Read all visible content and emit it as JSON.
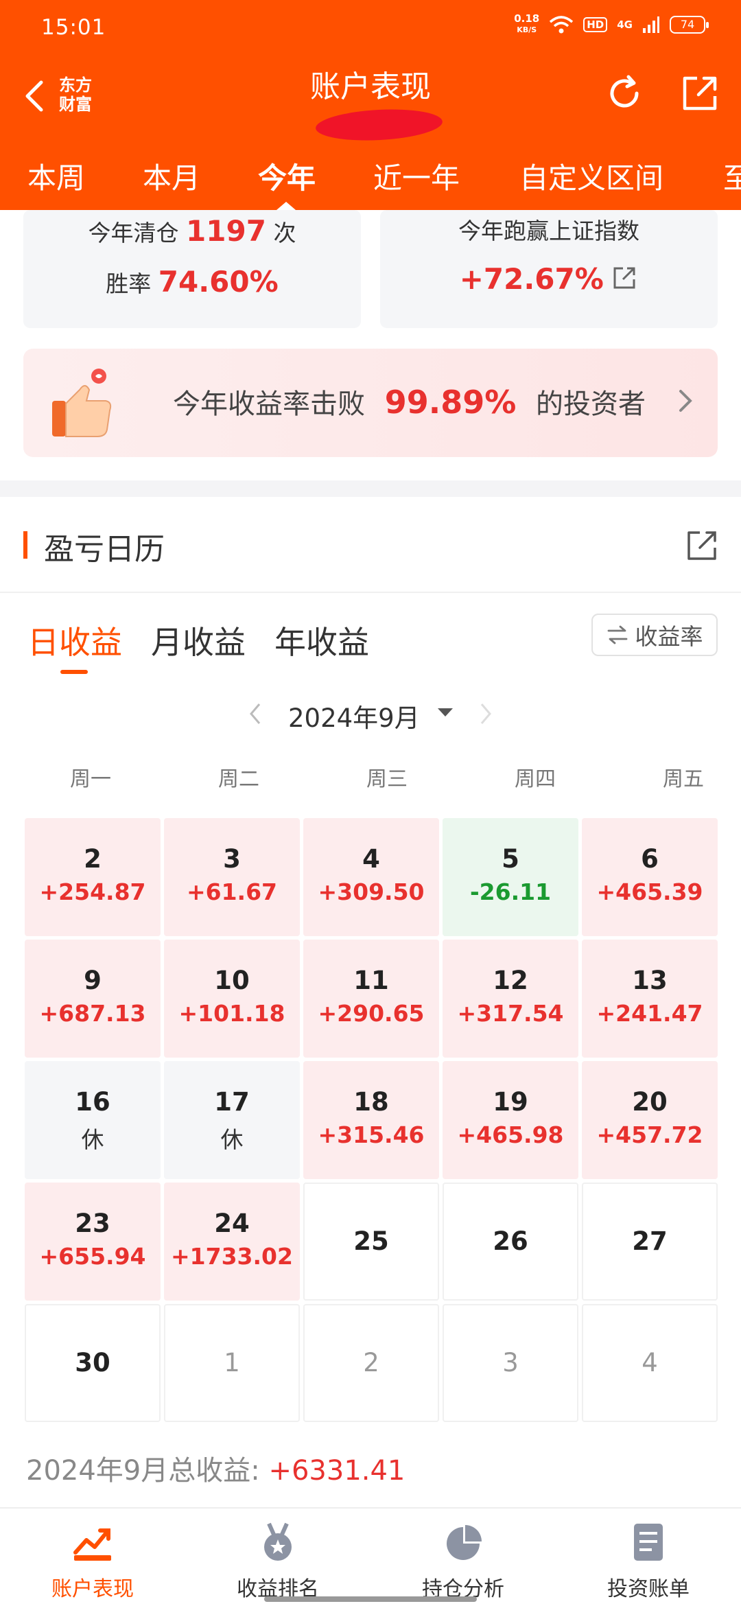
{
  "status_bar": {
    "time": "15:01",
    "net_speed_value": "0.18",
    "net_speed_unit": "KB/S",
    "hd": "HD",
    "network": "4G",
    "battery": "74"
  },
  "header": {
    "logo_line1": "东方",
    "logo_line2": "财富",
    "title": "账户表现",
    "tabs": [
      "本周",
      "本月",
      "今年",
      "近一年",
      "自定义区间",
      "至"
    ],
    "active_tab": "今年"
  },
  "summary": {
    "clear": {
      "prefix": "今年清仓",
      "count": "1197",
      "suffix": "次"
    },
    "winrate": {
      "label": "胜率",
      "value": "74.60%"
    },
    "beat_index": {
      "label": "今年跑赢上证指数",
      "value": "+72.67%"
    }
  },
  "beat_banner": {
    "prefix": "今年收益率击败",
    "value": "99.89%",
    "suffix": "的投资者"
  },
  "calendar_section": {
    "title": "盈亏日历",
    "subtabs": [
      "日收益",
      "月收益",
      "年收益"
    ],
    "active_subtab": "日收益",
    "toggle_label": "收益率",
    "month_label": "2024年9月",
    "weekdays": [
      "周一",
      "周二",
      "周三",
      "周四",
      "周五"
    ],
    "rows": [
      [
        {
          "day": "2",
          "value": "+254.87",
          "type": "pos"
        },
        {
          "day": "3",
          "value": "+61.67",
          "type": "pos"
        },
        {
          "day": "4",
          "value": "+309.50",
          "type": "pos"
        },
        {
          "day": "5",
          "value": "-26.11",
          "type": "neg"
        },
        {
          "day": "6",
          "value": "+465.39",
          "type": "pos"
        }
      ],
      [
        {
          "day": "9",
          "value": "+687.13",
          "type": "pos"
        },
        {
          "day": "10",
          "value": "+101.18",
          "type": "pos"
        },
        {
          "day": "11",
          "value": "+290.65",
          "type": "pos"
        },
        {
          "day": "12",
          "value": "+317.54",
          "type": "pos"
        },
        {
          "day": "13",
          "value": "+241.47",
          "type": "pos"
        }
      ],
      [
        {
          "day": "16",
          "value": "休",
          "type": "rest"
        },
        {
          "day": "17",
          "value": "休",
          "type": "rest"
        },
        {
          "day": "18",
          "value": "+315.46",
          "type": "pos"
        },
        {
          "day": "19",
          "value": "+465.98",
          "type": "pos"
        },
        {
          "day": "20",
          "value": "+457.72",
          "type": "pos"
        }
      ],
      [
        {
          "day": "23",
          "value": "+655.94",
          "type": "pos"
        },
        {
          "day": "24",
          "value": "+1733.02",
          "type": "pos"
        },
        {
          "day": "25",
          "value": "",
          "type": "empty"
        },
        {
          "day": "26",
          "value": "",
          "type": "empty"
        },
        {
          "day": "27",
          "value": "",
          "type": "empty"
        }
      ],
      [
        {
          "day": "30",
          "value": "",
          "type": "empty"
        },
        {
          "day": "1",
          "value": "",
          "type": "next"
        },
        {
          "day": "2",
          "value": "",
          "type": "next"
        },
        {
          "day": "3",
          "value": "",
          "type": "next"
        },
        {
          "day": "4",
          "value": "",
          "type": "next"
        }
      ]
    ],
    "total_label": "2024年9月总收益:",
    "total_value": "+6331.41"
  },
  "colors": {
    "brand": "#ff5000",
    "gain": "#e8312e",
    "loss": "#1a9a30"
  },
  "bottom_nav": [
    {
      "label": "账户表现",
      "icon": "trend-chart-icon",
      "active": true
    },
    {
      "label": "收益排名",
      "icon": "medal-icon",
      "active": false
    },
    {
      "label": "持仓分析",
      "icon": "pie-chart-icon",
      "active": false
    },
    {
      "label": "投资账单",
      "icon": "bill-icon",
      "active": false
    }
  ]
}
